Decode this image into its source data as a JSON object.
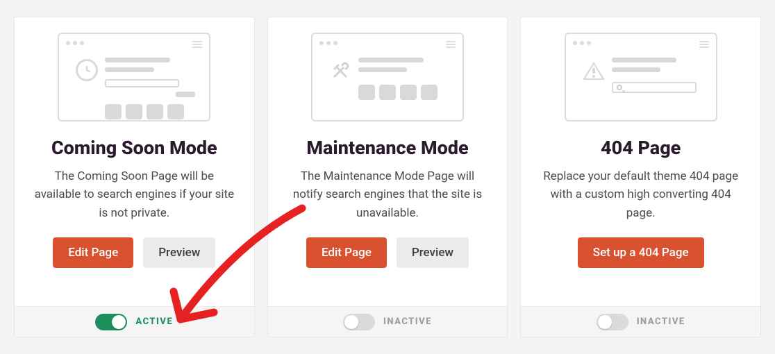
{
  "colors": {
    "accent": "#d9512f",
    "active_green": "#1b8f5c"
  },
  "buttons": {
    "edit_page": "Edit Page",
    "preview": "Preview",
    "setup_404": "Set up a 404 Page"
  },
  "status_labels": {
    "active": "ACTIVE",
    "inactive": "INACTIVE"
  },
  "cards": [
    {
      "icon": "clock-icon",
      "title": "Coming Soon Mode",
      "description": "The Coming Soon Page will be available to search engines if your site is not private.",
      "active": true
    },
    {
      "icon": "tools-icon",
      "title": "Maintenance Mode",
      "description": "The Maintenance Mode Page will notify search engines that the site is unavailable.",
      "active": false
    },
    {
      "icon": "warning-icon",
      "title": "404 Page",
      "description": "Replace your default theme 404 page with a custom high converting 404 page.",
      "active": false
    }
  ]
}
